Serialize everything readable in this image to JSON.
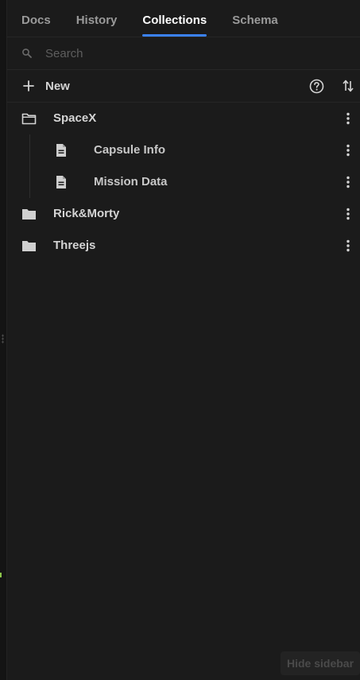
{
  "tabs": [
    {
      "label": "Docs",
      "active": false
    },
    {
      "label": "History",
      "active": false
    },
    {
      "label": "Collections",
      "active": true
    },
    {
      "label": "Schema",
      "active": false
    }
  ],
  "search": {
    "placeholder": "Search",
    "value": ""
  },
  "toolbar": {
    "new_label": "New",
    "help_icon": "help-circle-icon",
    "sort_icon": "sort-icon"
  },
  "collections": [
    {
      "label": "SpaceX",
      "icon": "folder-open-icon",
      "expanded": true,
      "requests": [
        {
          "label": "Capsule Info",
          "icon": "document-icon"
        },
        {
          "label": "Mission Data",
          "icon": "document-icon"
        }
      ]
    },
    {
      "label": "Rick&Morty",
      "icon": "folder-icon",
      "expanded": false
    },
    {
      "label": "Threejs",
      "icon": "folder-icon",
      "expanded": false
    }
  ],
  "footer": {
    "hide_sidebar_label": "Hide sidebar"
  },
  "colors": {
    "background": "#1b1b1b",
    "accent": "#3b82f6",
    "text": "#d4d4d4",
    "muted": "#9a9a9a"
  }
}
